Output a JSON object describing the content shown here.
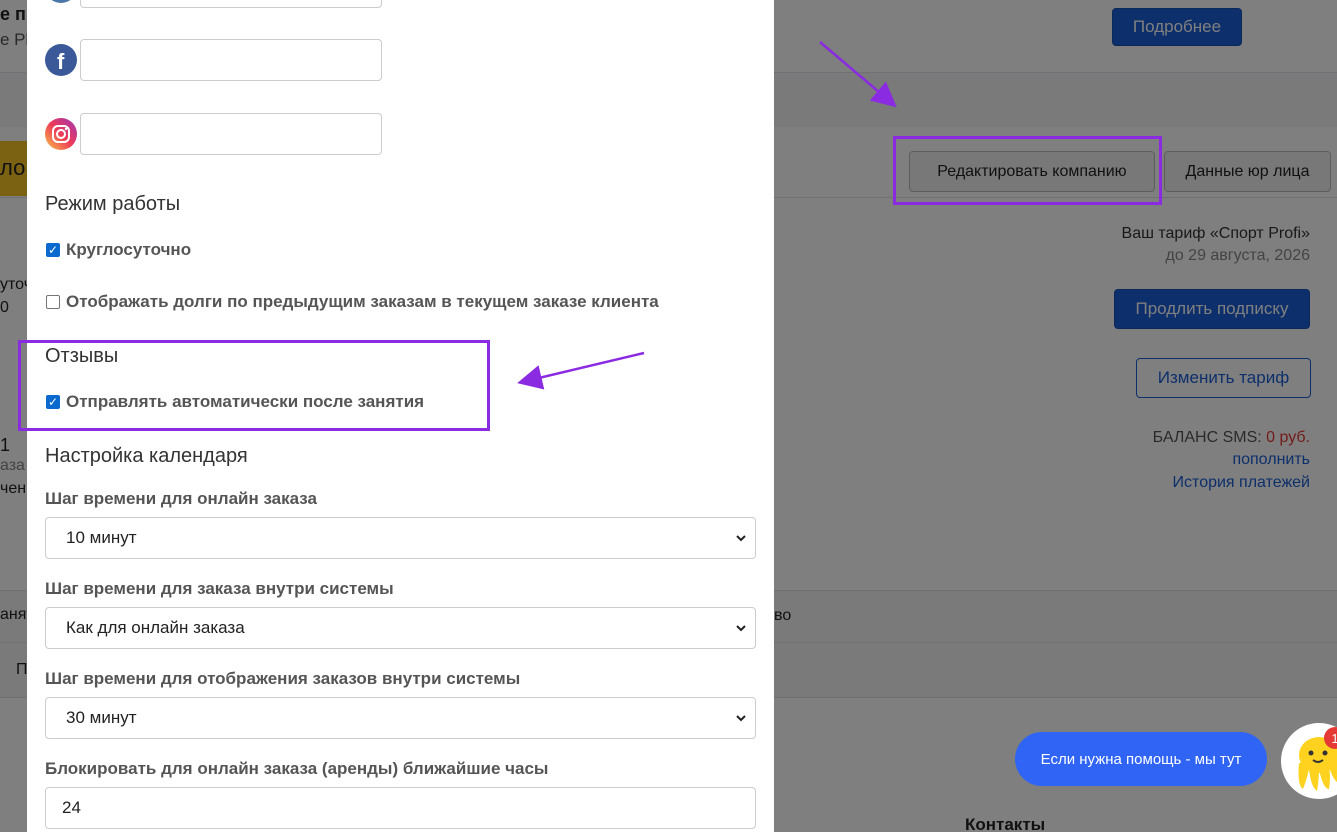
{
  "background": {
    "header_fragment_1": "е п",
    "header_fragment_2": "е Pl",
    "more_button": "Подробнее",
    "edit_company_button": "Редактировать компанию",
    "legal_data_button": "Данные юр лица",
    "yellow_tab_fragment": "ло",
    "left_fragment_1": "уточ",
    "left_fragment_2": "0",
    "left_fragment_3": "1",
    "left_fragment_4": "аза",
    "left_fragment_5": "чен",
    "left_fragment_6": "анят",
    "left_fragment_7": "Пр",
    "tariff_line": "Ваш тариф «Спорт Profi»",
    "tariff_until": "до 29 августа, 2026",
    "extend_subscription_button": "Продлить подписку",
    "change_tariff_button": "Изменить тариф",
    "sms_balance_label": "БАЛАНС SMS:",
    "sms_balance_value": "0 руб.",
    "top_up_link": "пополнить",
    "payment_history_link": "История платежей",
    "mid_fragment": "во",
    "contacts_heading": "Контакты"
  },
  "modal": {
    "social": [
      {
        "icon": "facebook-icon",
        "value": ""
      },
      {
        "icon": "instagram-icon",
        "value": ""
      }
    ],
    "work_mode_title": "Режим работы",
    "around_the_clock_label": "Круглосуточно",
    "around_the_clock_checked": true,
    "show_debts_label": "Отображать долги по предыдущим заказам в текущем заказе клиента",
    "show_debts_checked": false,
    "reviews_title": "Отзывы",
    "auto_send_label": "Отправлять автоматически после занятия",
    "auto_send_checked": true,
    "calendar_title": "Настройка календаря",
    "online_step_label": "Шаг времени для онлайн заказа",
    "online_step_value": "10 минут",
    "internal_step_label": "Шаг времени для заказа внутри системы",
    "internal_step_value": "Как для онлайн заказа",
    "display_step_label": "Шаг времени для отображения заказов внутри системы",
    "display_step_value": "30 минут",
    "block_hours_label": "Блокировать для онлайн заказа (аренды) ближайшие часы",
    "block_hours_value": "24"
  },
  "chat": {
    "bubble_text": "Если нужна помощь - мы тут",
    "badge_count": "1"
  },
  "colors": {
    "primary": "#1a5fd6",
    "annotation": "#8a2be2",
    "danger": "#e53935",
    "chat": "#2f64f5"
  }
}
